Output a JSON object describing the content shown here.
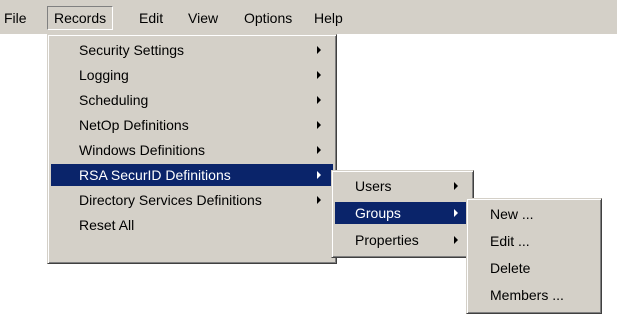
{
  "menubar": {
    "items": [
      {
        "label": "File"
      },
      {
        "label": "Records"
      },
      {
        "label": "Edit"
      },
      {
        "label": "View"
      },
      {
        "label": "Options"
      },
      {
        "label": "Help"
      }
    ]
  },
  "records_menu": {
    "items": [
      {
        "label": "Security Settings",
        "has_submenu": true
      },
      {
        "label": "Logging",
        "has_submenu": true
      },
      {
        "label": "Scheduling",
        "has_submenu": true
      },
      {
        "label": "NetOp Definitions",
        "has_submenu": true
      },
      {
        "label": "Windows Definitions",
        "has_submenu": true
      },
      {
        "label": "RSA SecurID Definitions",
        "has_submenu": true,
        "selected": true
      },
      {
        "label": "Directory Services Definitions",
        "has_submenu": true
      },
      {
        "label": "Reset All",
        "has_submenu": false
      }
    ]
  },
  "rsa_submenu": {
    "items": [
      {
        "label": "Users",
        "has_submenu": true
      },
      {
        "label": "Groups",
        "has_submenu": true,
        "selected": true
      },
      {
        "label": "Properties",
        "has_submenu": true
      }
    ]
  },
  "groups_submenu": {
    "items": [
      {
        "label": "New ..."
      },
      {
        "label": "Edit ..."
      },
      {
        "label": "Delete"
      },
      {
        "label": "Members ..."
      }
    ]
  },
  "colors": {
    "menu_background": "#d4d0c8",
    "selection": "#0a246a",
    "selection_text": "#ffffff"
  }
}
